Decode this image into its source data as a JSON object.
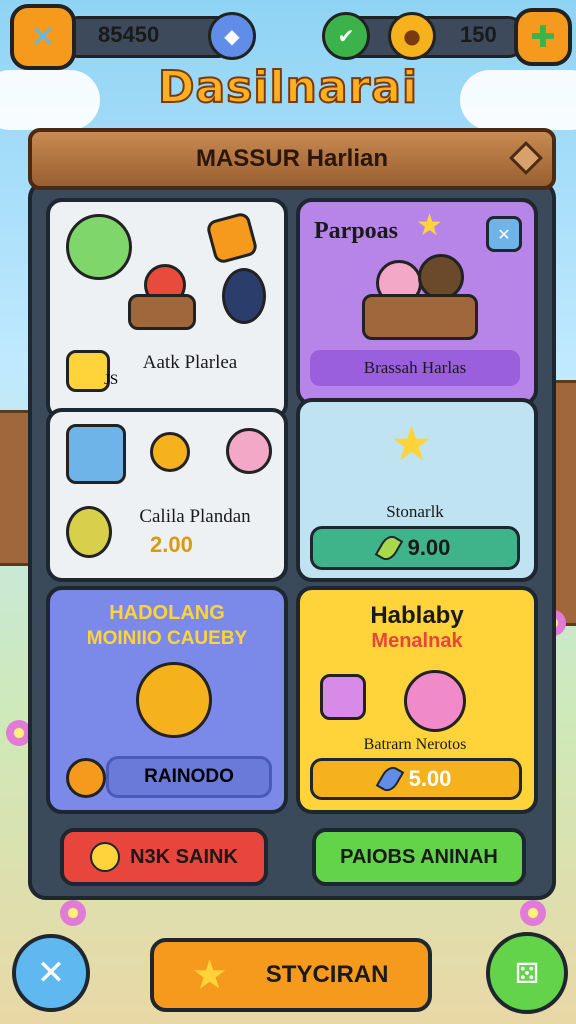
{
  "hud": {
    "close_icon": "close-x-icon",
    "left_currency": "85450",
    "right_currency": "150",
    "settings_icon": "puzzle-icon"
  },
  "title": "Dasilnarai",
  "panel_header": "MASSUR Harlian",
  "cards": {
    "c1": {
      "label": "Aatk Plarlea",
      "badge": "JS"
    },
    "c2": {
      "title": "Parpoas",
      "label": "Brassah Harlas"
    },
    "c3": {
      "label": "Calila Plandan",
      "price": "2.00"
    },
    "c4": {
      "label": "Stonarlk",
      "price": "9.00"
    },
    "c5": {
      "title1": "HADOLANG",
      "title2": "MOINIIO CAUEBY",
      "price": "RAINODO"
    },
    "c6": {
      "title1": "Hablaby",
      "title2": "Menalnak",
      "label": "Batrarn Nerotos",
      "price": "5.00"
    }
  },
  "buttons": {
    "left": "N3K SAINK",
    "right": "PAIOBS ANINAH"
  },
  "bottom": {
    "center": "STYCIRAN"
  },
  "colors": {
    "orange": "#f59a1c",
    "purple": "#a96ee0",
    "blue": "#7b8ae8",
    "yellow": "#ffd43b",
    "red": "#e8453c",
    "green": "#63d44a"
  }
}
